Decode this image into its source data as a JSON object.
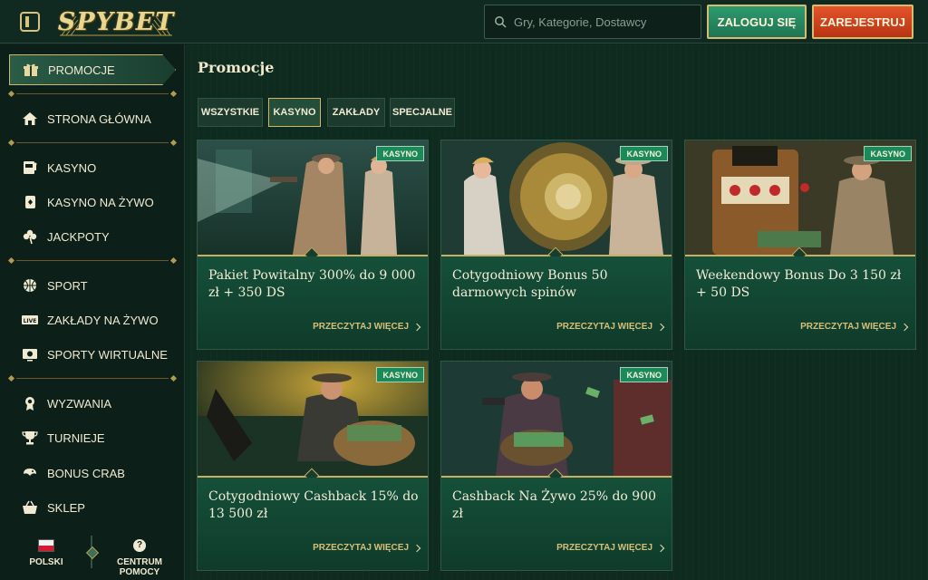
{
  "header": {
    "logo_text": "SPYBET",
    "search_placeholder": "Gry, Kategorie, Dostawcy",
    "login_label": "ZALOGUJ SIĘ",
    "register_label": "ZAREJESTRUJ"
  },
  "sidebar": {
    "items": [
      {
        "label": "PROMOCJE",
        "icon": "gift-icon",
        "active": true
      },
      {
        "label": "STRONA GŁÓWNA",
        "icon": "home-icon"
      },
      {
        "label": "KASYNO",
        "icon": "slot-machine-icon"
      },
      {
        "label": "KASYNO NA ŻYWO",
        "icon": "playing-card-icon"
      },
      {
        "label": "JACKPOTY",
        "icon": "clover-icon"
      },
      {
        "label": "SPORT",
        "icon": "basketball-icon"
      },
      {
        "label": "ZAKŁADY NA ŻYWO",
        "icon": "live-icon"
      },
      {
        "label": "SPORTY WIRTUALNE",
        "icon": "virtual-sports-icon"
      },
      {
        "label": "WYZWANIA",
        "icon": "medal-icon"
      },
      {
        "label": "TURNIEJE",
        "icon": "trophy-icon"
      },
      {
        "label": "BONUS CRAB",
        "icon": "crab-icon"
      },
      {
        "label": "SKLEP",
        "icon": "shopping-basket-icon"
      }
    ],
    "live_icon_text": "LIVE",
    "footer": {
      "language_label": "POLSKI",
      "help_label": "CENTRUM POMOCY",
      "help_icon_text": "?"
    }
  },
  "main": {
    "title": "Promocje",
    "tabs": [
      {
        "label": "WSZYSTKIE",
        "active": false
      },
      {
        "label": "KASYNO",
        "active": true
      },
      {
        "label": "ZAKŁADY",
        "active": false
      },
      {
        "label": "SPECJALNE",
        "active": false
      }
    ],
    "cards": [
      {
        "badge": "KASYNO",
        "title": "Pakiet Powitalny 300% do 9 000 zł + 350 DS",
        "link": "PRZECZYTAJ WIĘCEJ"
      },
      {
        "badge": "KASYNO",
        "title": "Cotygodniowy Bonus 50 darmowych spinów",
        "link": "PRZECZYTAJ WIĘCEJ"
      },
      {
        "badge": "KASYNO",
        "title": "Weekendowy Bonus Do 3 150 zł + 50 DS",
        "link": "PRZECZYTAJ WIĘCEJ"
      },
      {
        "badge": "KASYNO",
        "title": "Cotygodniowy Cashback 15% do 13 500 zł",
        "link": "PRZECZYTAJ WIĘCEJ"
      },
      {
        "badge": "KASYNO",
        "title": "Cashback Na Żywo 25% do 900 zł",
        "link": "PRZECZYTAJ WIĘCEJ"
      }
    ]
  },
  "colors": {
    "accent_gold": "#cfb66a",
    "login_green": "#2e9a6e",
    "register_red": "#e3542a",
    "badge_green": "#1b8a5a",
    "background": "#0f241c"
  }
}
